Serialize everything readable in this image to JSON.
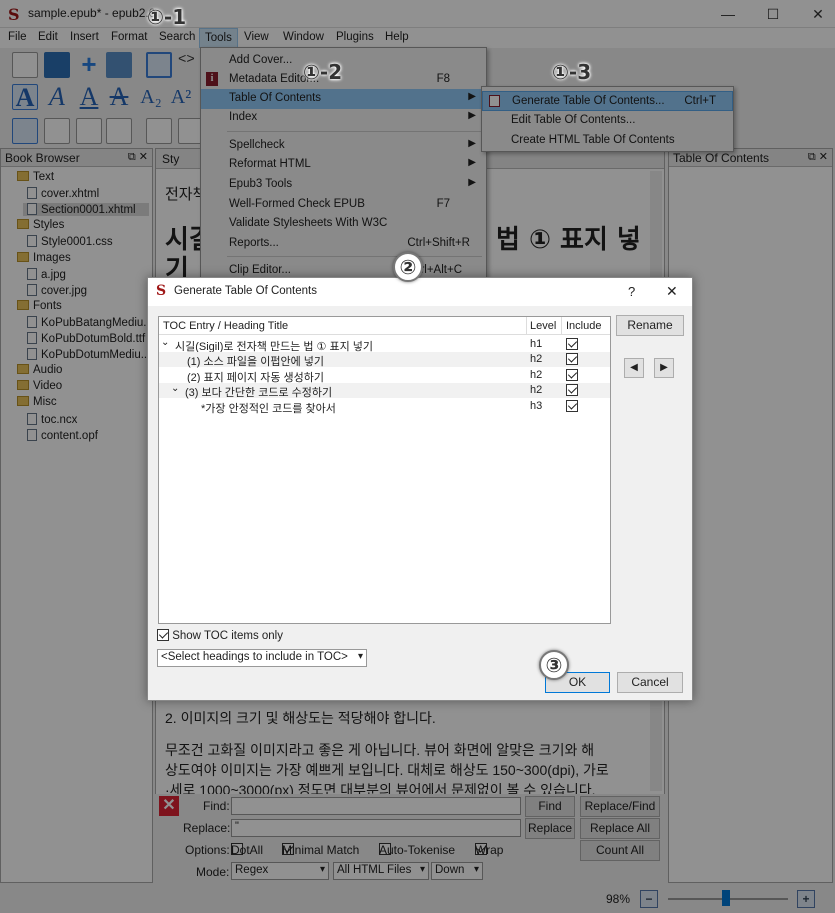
{
  "window": {
    "title": "sample.epub* - epub2.0",
    "minimize": "—",
    "maximize": "☐",
    "close": "✕"
  },
  "menubar": {
    "items": [
      "File",
      "Edit",
      "Insert",
      "Format",
      "Search",
      "Tools",
      "View",
      "Window",
      "Plugins",
      "Help"
    ]
  },
  "book_browser": {
    "title": "Book Browser",
    "items": [
      {
        "label": "Text",
        "type": "folder"
      },
      {
        "label": "cover.xhtml",
        "type": "file"
      },
      {
        "label": "Section0001.xhtml",
        "type": "file"
      },
      {
        "label": "Styles",
        "type": "folder"
      },
      {
        "label": "Style0001.css",
        "type": "file"
      },
      {
        "label": "Images",
        "type": "folder"
      },
      {
        "label": "a.jpg",
        "type": "file"
      },
      {
        "label": "cover.jpg",
        "type": "file"
      },
      {
        "label": "Fonts",
        "type": "folder"
      },
      {
        "label": "KoPubBatangMediu...",
        "type": "file"
      },
      {
        "label": "KoPubDotumBold.ttf",
        "type": "file"
      },
      {
        "label": "KoPubDotumMediu...",
        "type": "file"
      },
      {
        "label": "Audio",
        "type": "folder"
      },
      {
        "label": "Video",
        "type": "folder"
      },
      {
        "label": "Misc",
        "type": "folder"
      },
      {
        "label": "toc.ncx",
        "type": "file"
      },
      {
        "label": "content.opf",
        "type": "file"
      }
    ]
  },
  "toc_panel": {
    "title": "Table Of Contents"
  },
  "editor": {
    "tab": "Sty",
    "line1": "전자책",
    "heading": "시길",
    "heading_right": "법 ① 표지 넣",
    "heading2": "기",
    "para1": "2. 이미지의 크기 및 해상도는 적당해야 합니다.",
    "para2a": "무조건 고화질 이미지라고 좋은 게 아닙니다. 뷰어 화면에 알맞은 크기와 해",
    "para2b": "상도여야 이미지는 가장 예쁘게 보입니다. 대체로 해상도 150~300(dpi), 가로",
    "para2c": "·세로 1000~3000(px) 정도면 대부분의 뷰어에서 문제없이 볼 수 있습니다."
  },
  "tools_menu": {
    "items": [
      {
        "label": "Add Cover...",
        "shortcut": "",
        "submenu": false
      },
      {
        "label": "Metadata Editor...",
        "shortcut": "F8",
        "submenu": false
      },
      {
        "label": "Table Of Contents",
        "shortcut": "",
        "submenu": true
      },
      {
        "label": "Index",
        "shortcut": "",
        "submenu": true
      },
      {
        "label": "Spellcheck",
        "shortcut": "",
        "submenu": true
      },
      {
        "label": "Reformat HTML",
        "shortcut": "",
        "submenu": true
      },
      {
        "label": "Epub3 Tools",
        "shortcut": "",
        "submenu": true
      },
      {
        "label": "Well-Formed Check EPUB",
        "shortcut": "F7",
        "submenu": false
      },
      {
        "label": "Validate Stylesheets With W3C",
        "shortcut": "",
        "submenu": false
      },
      {
        "label": "Reports...",
        "shortcut": "Ctrl+Shift+R",
        "submenu": false
      },
      {
        "label": "Clip Editor...",
        "shortcut": "Ctrl+Alt+C",
        "submenu": false
      }
    ]
  },
  "toc_submenu": {
    "items": [
      {
        "label": "Generate Table Of Contents...",
        "shortcut": "Ctrl+T"
      },
      {
        "label": "Edit Table Of Contents...",
        "shortcut": ""
      },
      {
        "label": "Create HTML Table Of Contents",
        "shortcut": ""
      }
    ]
  },
  "dialog": {
    "title": "Generate Table Of Contents",
    "help": "?",
    "close": "✕",
    "columns": [
      "TOC Entry / Heading Title",
      "Level",
      "Include"
    ],
    "rows": [
      {
        "toggle": "⌄",
        "title": "시길(Sigil)로 전자책 만드는 법 ① 표지 넣기",
        "level": "h1",
        "include": true
      },
      {
        "toggle": "",
        "title": "(1) 소스 파일을 이펍안에 넣기",
        "level": "h2",
        "include": true
      },
      {
        "toggle": "",
        "title": "(2) 표지 페이지 자동 생성하기",
        "level": "h2",
        "include": true
      },
      {
        "toggle": "⌄",
        "title": "(3) 보다 간단한 코드로 수정하기",
        "level": "h2",
        "include": true
      },
      {
        "toggle": "",
        "title": "*가장 안정적인 코드를 찾아서",
        "level": "h3",
        "include": true
      }
    ],
    "rename": "Rename",
    "show_toc_only": "Show TOC items only",
    "select_headings": "<Select headings to include in TOC>",
    "ok": "OK",
    "cancel": "Cancel"
  },
  "findbar": {
    "find_label": "Find:",
    "replace_label": "Replace:",
    "replace_value": "\"",
    "options_label": "Options:",
    "mode_label": "Mode:",
    "find_btn": "Find",
    "replace_find_btn": "Replace/Find",
    "replace_btn": "Replace",
    "replace_all_btn": "Replace All",
    "count_all_btn": "Count All",
    "opt_dotall": "DotAll",
    "opt_minimal": "Minimal Match",
    "opt_autotokenise": "Auto-Tokenise",
    "opt_wrap": "Wrap",
    "mode_value": "Regex",
    "scope_value": "All HTML Files",
    "direction_value": "Down"
  },
  "statusbar": {
    "zoom": "98%"
  },
  "callouts": {
    "c11": "①-1",
    "c12": "①-2",
    "c13": "①-3",
    "c2": "②",
    "c3": "③"
  },
  "colors": {
    "highlight": "#91c9f7",
    "accent": "#0078d7",
    "logo": "#a01818"
  }
}
